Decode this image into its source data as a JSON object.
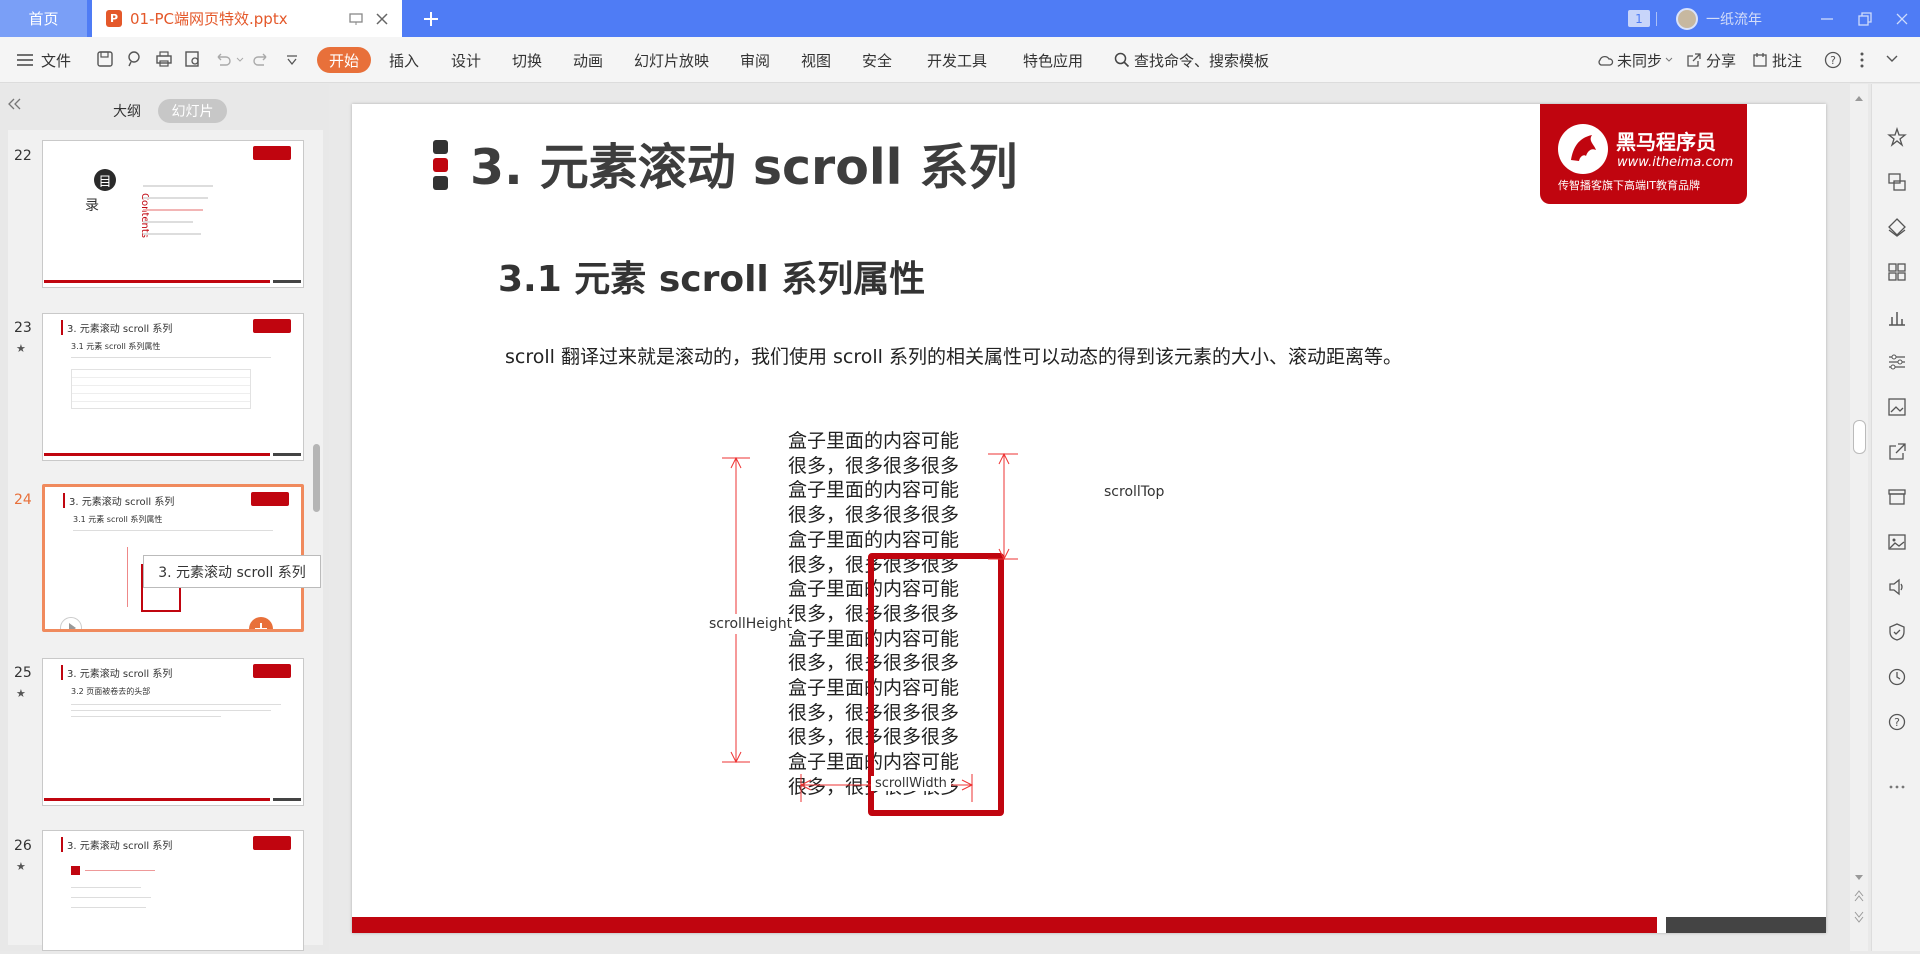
{
  "titlebar": {
    "home_tab": "首页",
    "doc_tab": "01-PC端网页特效.pptx",
    "doc_icon": "P",
    "page_badge": "1",
    "user": "一纸流年"
  },
  "menu": {
    "file": "文件",
    "items": [
      "开始",
      "插入",
      "设计",
      "切换",
      "动画",
      "幻灯片放映",
      "审阅",
      "视图",
      "安全",
      "开发工具",
      "特色应用"
    ],
    "search": "查找命令、搜索模板",
    "sync": "未同步",
    "share": "分享",
    "comment": "批注"
  },
  "sidebar": {
    "tab_outline": "大纲",
    "tab_slides": "幻灯片",
    "tooltip": "3. 元素滚动 scroll 系列",
    "slides": [
      {
        "num": "22",
        "star": ""
      },
      {
        "num": "23",
        "star": "★",
        "title": "3. 元素滚动 scroll 系列",
        "subtitle": "3.1 元素 scroll 系列属性"
      },
      {
        "num": "24",
        "star": "★",
        "title": "3. 元素滚动 scroll 系列",
        "subtitle": "3.1 元素 scroll 系列属性"
      },
      {
        "num": "25",
        "star": "★",
        "title": "3. 元素滚动 scroll 系列",
        "subtitle": "3.2 页面被卷去的头部"
      },
      {
        "num": "26",
        "star": "★",
        "title": "3. 元素滚动 scroll 系列"
      }
    ],
    "slide22": {
      "mu": "目",
      "lu": "录",
      "contents": "Contents"
    }
  },
  "slide": {
    "title": "3. 元素滚动 scroll 系列",
    "subtitle": "3.1 元素 scroll 系列属性",
    "body": "scroll 翻译过来就是滚动的，我们使用 scroll 系列的相关属性可以动态的得到该元素的大小、滚动距离等。",
    "logo_name": "黑马程序员",
    "logo_url": "www.itheima.com",
    "logo_tag": "传智播客旗下高端IT教育品牌",
    "diagram": {
      "lines": [
        "盒子里面的内容可能",
        "很多，很多很多很多",
        "盒子里面的内容可能",
        "很多，很多很多很多",
        "盒子里面的内容可能",
        "很多，很多很多很多",
        "盒子里面的内容可能",
        "很多，很多很多很多",
        "盒子里面的内容可能",
        "很多，很多很多很多",
        "盒子里面的内容可能",
        "很多，很多很多很多",
        "很多，很多很多很多",
        "盒子里面的内容可能",
        "很多，很多很多很多"
      ],
      "label_height": "scrollHeight",
      "label_top": "scrollTop",
      "label_width": "scrollWidth"
    }
  },
  "colors": {
    "accent": "#e8703a",
    "brand_red": "#c0050f",
    "titlebar": "#4f7cf5"
  }
}
